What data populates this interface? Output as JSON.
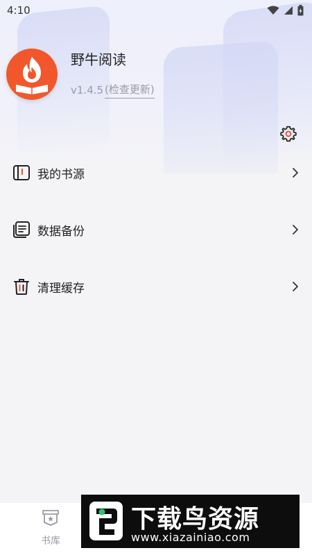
{
  "status_bar": {
    "time": "4:10",
    "icons": [
      "wifi-icon",
      "cellular-signal-icon",
      "battery-charging-icon"
    ]
  },
  "profile": {
    "app_name": "野牛阅读",
    "version": "v1.4.5",
    "check_update_label": "(检查更新)",
    "avatar_icon": "flame-book-logo-icon",
    "avatar_color": "#F2562A"
  },
  "settings": {
    "icon": "gear-icon"
  },
  "menu": {
    "items": [
      {
        "label": "我的书源",
        "icon": "book-source-icon"
      },
      {
        "label": "数据备份",
        "icon": "data-backup-icon"
      },
      {
        "label": "清理缓存",
        "icon": "trash-icon"
      }
    ]
  },
  "bottom_nav": {
    "tabs": [
      {
        "label": "书库",
        "icon": "bookshelf-icon"
      }
    ]
  },
  "watermark": {
    "title": "下载鸟资源",
    "url": "www.xiazainiao.com"
  },
  "colors": {
    "accent": "#F2562A",
    "text_primary": "#222222",
    "text_secondary": "#9A9AA6",
    "background": "#F4F4F6"
  }
}
